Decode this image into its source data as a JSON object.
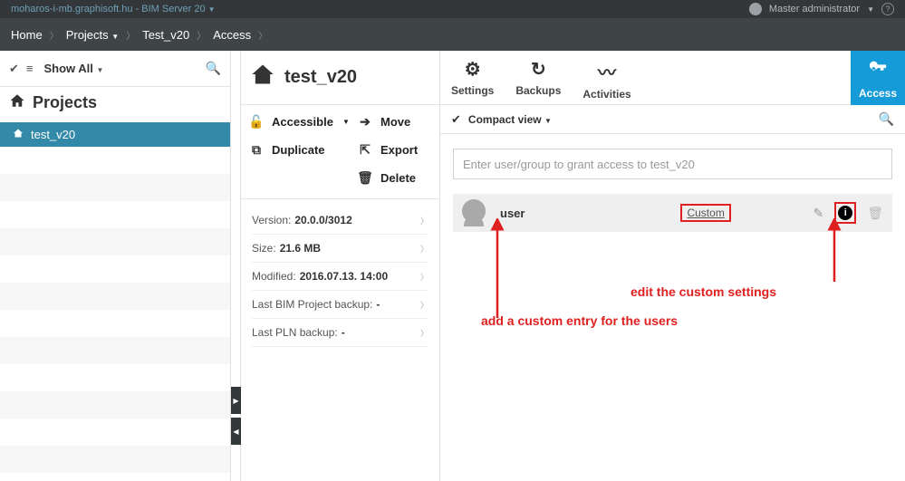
{
  "topbar": {
    "server": "moharos-i-mb.graphisoft.hu - BIM Server 20",
    "user": "Master administrator"
  },
  "breadcrumb": {
    "home": "Home",
    "projects": "Projects",
    "test": "Test_v20",
    "access": "Access"
  },
  "sidebar": {
    "showAll": "Show All",
    "sectionTitle": "Projects",
    "items": [
      {
        "label": "test_v20"
      }
    ]
  },
  "projectPanel": {
    "title": "test_v20",
    "actions": {
      "accessible": "Accessible",
      "move": "Move",
      "duplicate": "Duplicate",
      "export": "Export",
      "delete": "Delete"
    },
    "meta": {
      "versionLabel": "Version:",
      "versionValue": "20.0.0/3012",
      "sizeLabel": "Size:",
      "sizeValue": "21.6 MB",
      "modifiedLabel": "Modified:",
      "modifiedValue": "2016.07.13. 14:00",
      "lastBimLabel": "Last BIM Project backup:",
      "lastBimValue": "-",
      "lastPlnLabel": "Last PLN backup:",
      "lastPlnValue": "-"
    }
  },
  "tabs": {
    "settings": "Settings",
    "backups": "Backups",
    "activities": "Activities",
    "access": "Access"
  },
  "viewbar": {
    "label": "Compact view"
  },
  "accessInput": {
    "placeholder": "Enter user/group to grant access to test_v20"
  },
  "userRow": {
    "name": "user",
    "role": "Custom"
  },
  "annotations": {
    "addEntry": "add a custom entry for the users",
    "editCustom": "edit the custom settings"
  }
}
